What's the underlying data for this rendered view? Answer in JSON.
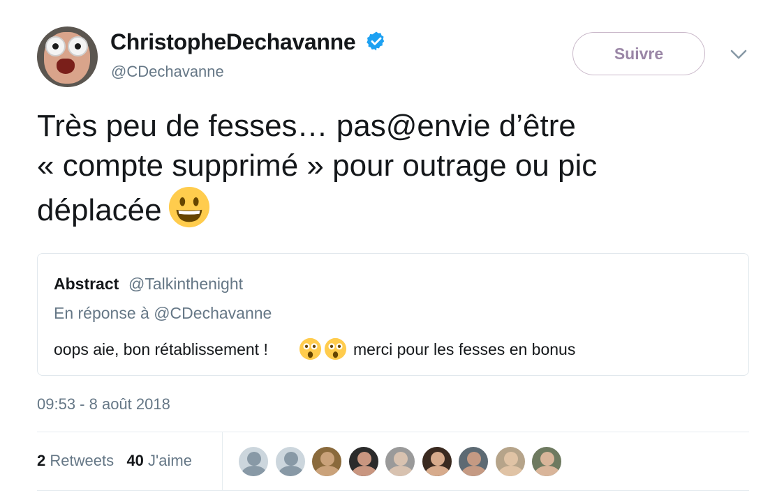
{
  "author": {
    "display_name": "ChristopheDechavanne",
    "handle": "@CDechavanne",
    "verified_icon": "verified-badge-icon",
    "colors": {
      "verified": "#1da1f2"
    }
  },
  "follow_button": {
    "label": "Suivre"
  },
  "menu": {
    "icon": "chevron-down-icon"
  },
  "tweet": {
    "lines": [
      "Très peu de fesses… pas@envie d’être",
      "« compte supprimé » pour outrage ou pic",
      "déplacée"
    ],
    "emoji": "grinning-face-emoji"
  },
  "quoted_tweet": {
    "name": "Abstract",
    "handle": "@Talkinthenight",
    "reply_to": "En réponse à @CDechavanne",
    "text_before": "oops aie, bon rétablissement !",
    "emojis": [
      "astonished-face-emoji",
      "astonished-face-emoji"
    ],
    "text_after": "merci pour les fesses en bonus"
  },
  "timestamp": "09:53 - 8 août 2018",
  "stats": {
    "retweets_count": "2",
    "retweets_label": "Retweets",
    "likes_count": "40",
    "likes_label": "J'aime"
  },
  "likers": [
    {
      "icon": "default-avatar-icon",
      "bg": "#ccd6dd",
      "fg": "#8899a6"
    },
    {
      "icon": "default-avatar-icon",
      "bg": "#ccd6dd",
      "fg": "#8899a6"
    },
    {
      "icon": "user-avatar",
      "bg": "#8a6a3c",
      "fg": "#caa27a"
    },
    {
      "icon": "user-avatar",
      "bg": "#2b2b2b",
      "fg": "#c99680"
    },
    {
      "icon": "user-avatar",
      "bg": "#9a9a9a",
      "fg": "#d8c2b0"
    },
    {
      "icon": "user-avatar",
      "bg": "#3a2a20",
      "fg": "#d7ab8c"
    },
    {
      "icon": "user-avatar",
      "bg": "#5d6a73",
      "fg": "#c59a83"
    },
    {
      "icon": "user-avatar",
      "bg": "#b6a48a",
      "fg": "#e0c3a5"
    },
    {
      "icon": "user-avatar",
      "bg": "#6e7a60",
      "fg": "#d9b59a"
    }
  ]
}
